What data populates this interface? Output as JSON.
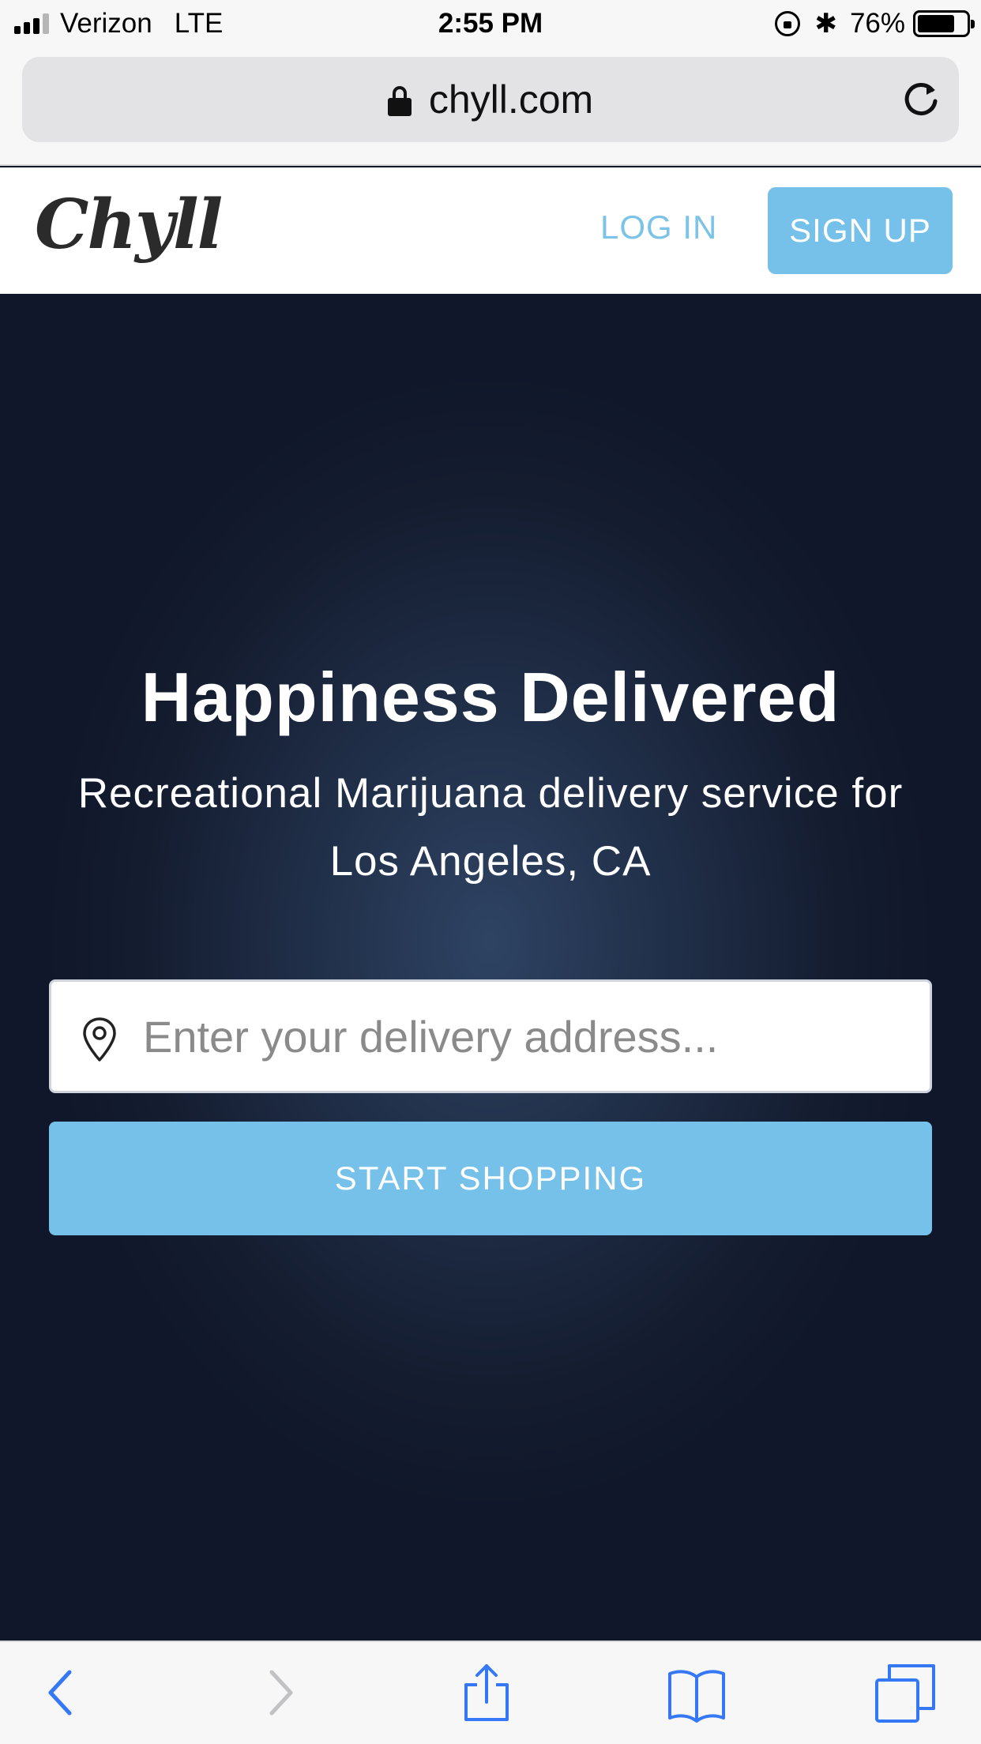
{
  "status_bar": {
    "carrier": "Verizon",
    "network": "LTE",
    "time": "2:55 PM",
    "battery_percent": "76%",
    "battery_level": 0.76
  },
  "browser": {
    "url": "chyll.com"
  },
  "header": {
    "logo": "Chyll",
    "login_label": "LOG IN",
    "signup_label": "SIGN UP"
  },
  "hero": {
    "title": "Happiness Delivered",
    "subtitle": "Recreational Marijuana delivery service for Los Angeles, CA",
    "address_placeholder": "Enter your delivery address...",
    "address_value": "",
    "cta_label": "START SHOPPING"
  },
  "colors": {
    "accent": "#76c1ea",
    "hero_bg": "#141c2f",
    "ios_blue": "#3478f6"
  },
  "icons": {
    "toolbar": [
      "back-icon",
      "forward-icon",
      "share-icon",
      "bookmarks-icon",
      "tabs-icon"
    ]
  }
}
